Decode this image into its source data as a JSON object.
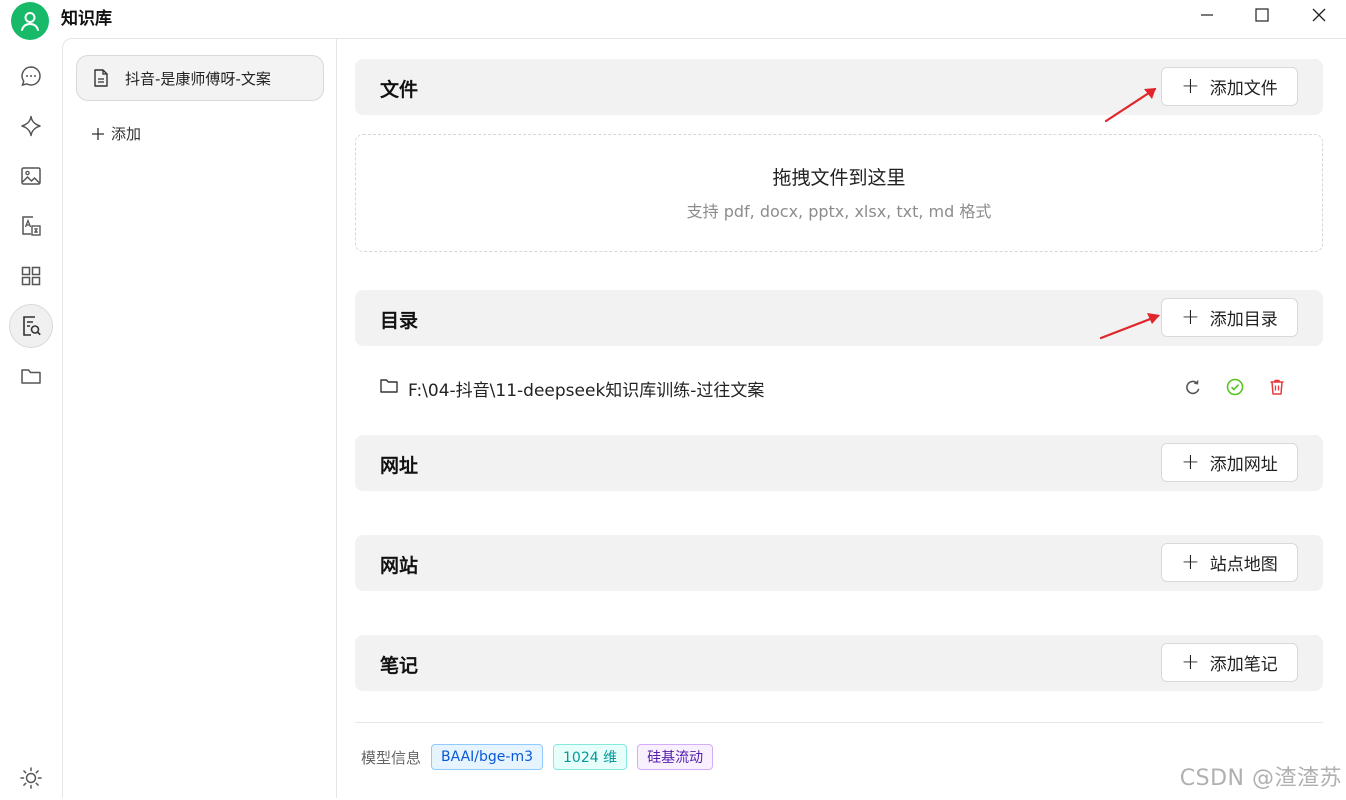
{
  "window": {
    "title": "知识库",
    "minimize_icon": "minimize-icon",
    "maximize_icon": "maximize-icon",
    "close_icon": "close-icon"
  },
  "rail": {
    "items": [
      {
        "icon": "chat-icon"
      },
      {
        "icon": "sparkle-icon"
      },
      {
        "icon": "image-icon"
      },
      {
        "icon": "translate-icon"
      },
      {
        "icon": "apps-grid-icon"
      },
      {
        "icon": "knowledge-search-icon",
        "active": true
      },
      {
        "icon": "folder-icon"
      }
    ],
    "bottom_icon": "theme-sun-icon"
  },
  "knowledge_list": {
    "items": [
      {
        "label": "抖音-是康师傅呀-文案",
        "icon": "document-icon"
      }
    ],
    "add_label": "添加"
  },
  "sections": {
    "files": {
      "title": "文件",
      "button": "添加文件"
    },
    "dropzone": {
      "title": "拖拽文件到这里",
      "subtitle": "支持 pdf, docx, pptx, xlsx, txt, md 格式"
    },
    "directories": {
      "title": "目录",
      "button": "添加目录"
    },
    "dir_entries": [
      {
        "path": "F:\\04-抖音\\11-deepseek知识库训练-过往文案"
      }
    ],
    "urls": {
      "title": "网址",
      "button": "添加网址"
    },
    "sites": {
      "title": "网站",
      "button": "站点地图"
    },
    "notes": {
      "title": "笔记",
      "button": "添加笔记"
    }
  },
  "model_info": {
    "label": "模型信息",
    "model": "BAAI/bge-m3",
    "dimensions": "1024 维",
    "provider": "硅基流动"
  },
  "watermark": "CSDN @渣渣苏",
  "colors": {
    "accent_green": "#19b96a",
    "annotation_arrow": "#e0262b",
    "delete_red": "#e8383d",
    "check_green": "#52c41a"
  }
}
